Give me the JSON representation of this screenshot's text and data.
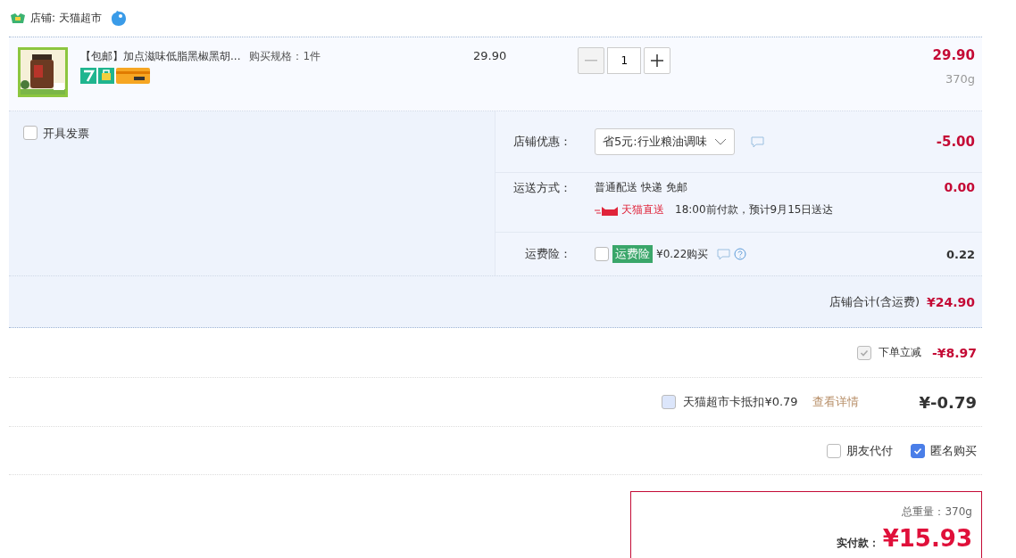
{
  "store": {
    "label": "店铺: 天猫超市"
  },
  "item": {
    "title": "【包邮】加点滋味低脂黑椒黑胡...",
    "spec": "购买规格：1件",
    "unit_price": "29.90",
    "quantity": "1",
    "total": "29.90",
    "weight": "370g",
    "minus_disabled": true
  },
  "invoice": {
    "label": "开具发票",
    "checked": false
  },
  "discount": {
    "label": "店铺优惠：",
    "value": "省5元:行业粮油调味",
    "amount": "-5.00"
  },
  "shipping": {
    "label": "运送方式：",
    "method": "普通配送 快递 免邮",
    "badge": "天猫直送",
    "eta": "18:00前付款，预计9月15日送达",
    "amount": "0.00"
  },
  "insurance": {
    "label": "运费险：",
    "checked": false,
    "tag": "运费险",
    "price": "¥0.22购买",
    "amount": "0.22"
  },
  "store_total": {
    "label": "店铺合计(含运费)",
    "amount": "¥24.90"
  },
  "instant_discount": {
    "label": "下单立减",
    "checked": true,
    "disabled": true,
    "amount": "-¥8.97"
  },
  "card_deduction": {
    "label": "天猫超市卡抵扣¥0.79",
    "checked": false,
    "link": "查看详情",
    "amount": "¥-0.79"
  },
  "extras": [
    {
      "label": "朋友代付",
      "checked": false
    },
    {
      "label": "匿名购买",
      "checked": true
    }
  ],
  "summary": {
    "weight": "总重量：370g",
    "pay_label": "实付款：",
    "pay_amount": "¥15.93"
  }
}
